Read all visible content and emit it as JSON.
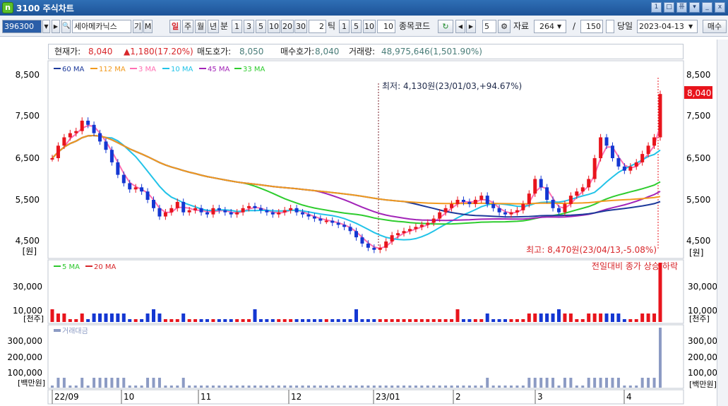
{
  "window": {
    "title": "3100 주식차트",
    "app_icon": "n",
    "buttons": [
      "1",
      "□",
      "퓨",
      "▾",
      "_",
      "x"
    ]
  },
  "toolbar": {
    "code": "396300",
    "stock_name": "세아메카닉스",
    "btn_gi": "기",
    "btn_m": "M",
    "periods": [
      "일",
      "주",
      "월",
      "년",
      "분"
    ],
    "selected_period": "일",
    "minute_options": [
      "1",
      "3",
      "5",
      "10",
      "20",
      "30"
    ],
    "minute_input": "2",
    "tick_label": "틱",
    "tick_options": [
      "1",
      "5",
      "10"
    ],
    "tick_input": "10",
    "code_label": "종목코드",
    "count_input": "5",
    "data_label": "자료",
    "data_count": "264",
    "slash": "/",
    "display_count": "150",
    "today_label": "당일",
    "date": "2023-04-13",
    "sell_label": "매수"
  },
  "info": {
    "price_label": "현재가:",
    "price": "8,040",
    "change": "▲1,180(17.20%)",
    "ask_label": "매도호가:",
    "ask": "8,050",
    "bid_label": "매수호가:",
    "bid": "8,040",
    "volume_label": "거래량:",
    "volume": "48,975,646(1,501.90%)"
  },
  "colors": {
    "up": "#e8141c",
    "down": "#1437d2",
    "ma60": "#1d3a9b",
    "ma112": "#f29a1e",
    "ma3": "#ff6fb2",
    "ma10": "#22c3e8",
    "ma45": "#a224b8",
    "ma33": "#2ecc2e",
    "vma5": "#2ec82e",
    "vma20": "#d8262a",
    "amount": "#8c9bc4"
  },
  "chart_data": {
    "type": "candlestick",
    "y_ticks": [
      "8,500",
      "7,500",
      "6,500",
      "5,500",
      "4,500"
    ],
    "y_unit": "[원]",
    "current_price_label": "8,040",
    "legend": [
      "60 MA",
      "112 MA",
      "3 MA",
      "10 MA",
      "45 MA",
      "33 MA"
    ],
    "annotation_low": "최저: 4,130원(23/01/03,+94.67%)",
    "annotation_high": "최고: 8,470원(23/04/13,-5.08%)",
    "x_ticks": [
      "22/09",
      "10",
      "11",
      "12",
      "23/01",
      "2",
      "3",
      "4"
    ],
    "close_series": [
      6500,
      6800,
      7000,
      7100,
      7150,
      7400,
      7300,
      7100,
      6900,
      6700,
      6400,
      6100,
      5900,
      5750,
      5800,
      5700,
      5500,
      5300,
      5100,
      5200,
      5300,
      5450,
      5200,
      5250,
      5300,
      5200,
      5150,
      5300,
      5250,
      5200,
      5150,
      5200,
      5300,
      5350,
      5300,
      5250,
      5200,
      5150,
      5200,
      5250,
      5300,
      5200,
      5150,
      5100,
      5050,
      5000,
      5000,
      4950,
      4900,
      4850,
      4750,
      4600,
      4450,
      4350,
      4300,
      4350,
      4500,
      4650,
      4700,
      4750,
      4800,
      4850,
      4900,
      4950,
      5050,
      5200,
      5300,
      5400,
      5500,
      5450,
      5400,
      5500,
      5600,
      5400,
      5300,
      5200,
      5150,
      5200,
      5250,
      5400,
      5650,
      6000,
      5800,
      5500,
      5300,
      5200,
      5400,
      5600,
      5700,
      5800,
      6000,
      6500,
      7000,
      6800,
      6500,
      6300,
      6200,
      6300,
      6400,
      6600,
      6800,
      7000,
      8040
    ],
    "volume_ticks": [
      "30,000",
      "10,000"
    ],
    "volume_unit": "[천주]",
    "volume_legend": [
      "5 MA",
      "20 MA"
    ],
    "volume_note": "전일대비 종가 상승/하락",
    "amount_ticks": [
      "300,000",
      "200,000",
      "100,000"
    ],
    "amount_unit": "[백만원]",
    "amount_legend": "거래대금"
  }
}
